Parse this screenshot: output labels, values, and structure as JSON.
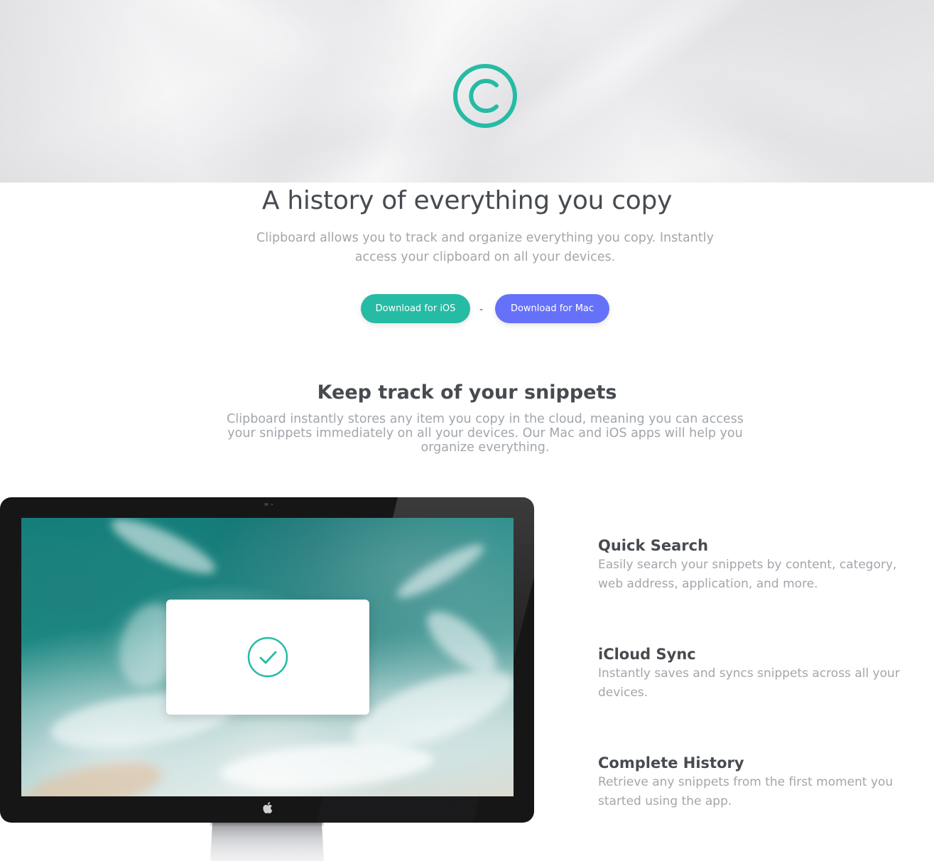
{
  "hero": {
    "logo_icon": "copyright-circle-icon",
    "accent_color": "#26bba4"
  },
  "intro": {
    "headline": "A history of everything you copy",
    "subtext": "Clipboard allows you to track and organize everything you copy. Instantly access your clipboard on all your devices."
  },
  "buttons": {
    "ios_label": "Download for iOS",
    "separator": "-",
    "mac_label": "Download for Mac",
    "ios_color": "#26bba4",
    "mac_color": "#6671f9"
  },
  "snippets": {
    "title": "Keep track of your snippets",
    "text": "Clipboard instantly stores any item you copy in the cloud, meaning you can access your snippets immediately on all your devices. Our Mac and iOS apps will help you organize everything."
  },
  "monitor": {
    "screen_image": "aerial-ocean-waves",
    "dialog_icon": "check-circle-icon",
    "brand_icon": "apple-icon"
  },
  "features": [
    {
      "title": "Quick Search",
      "text": "Easily search your snippets by content, category, web address, application, and more."
    },
    {
      "title": "iCloud Sync",
      "text": "Instantly saves and syncs snippets across all your devices."
    },
    {
      "title": "Complete History",
      "text": "Retrieve any snippets from the first moment you started using the app."
    }
  ]
}
